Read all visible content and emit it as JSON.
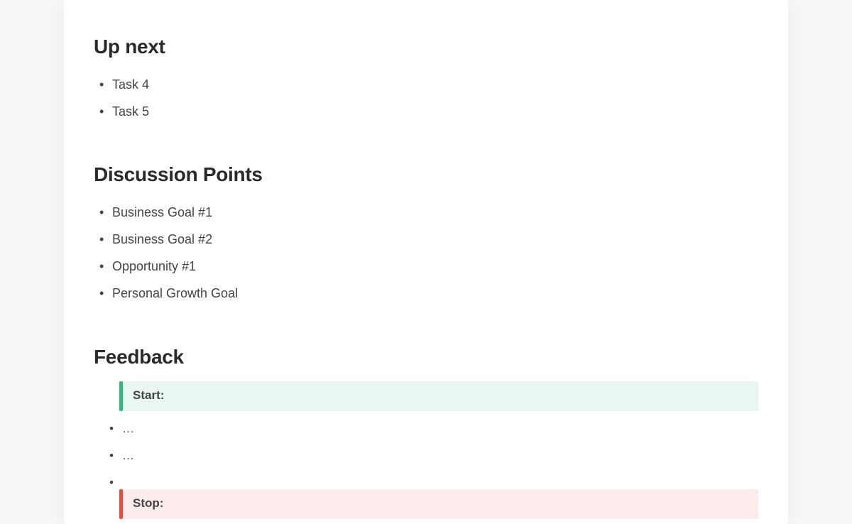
{
  "sections": {
    "up_next": {
      "heading": "Up next",
      "items": [
        "Task 4",
        "Task 5"
      ]
    },
    "discussion": {
      "heading": "Discussion Points",
      "items": [
        "Business Goal #1",
        "Business Goal #2",
        "Opportunity #1",
        "Personal Growth Goal"
      ]
    },
    "feedback": {
      "heading": "Feedback",
      "start_label": "Start:",
      "start_items": [
        "…",
        "…",
        ""
      ],
      "stop_label": "Stop:"
    }
  }
}
